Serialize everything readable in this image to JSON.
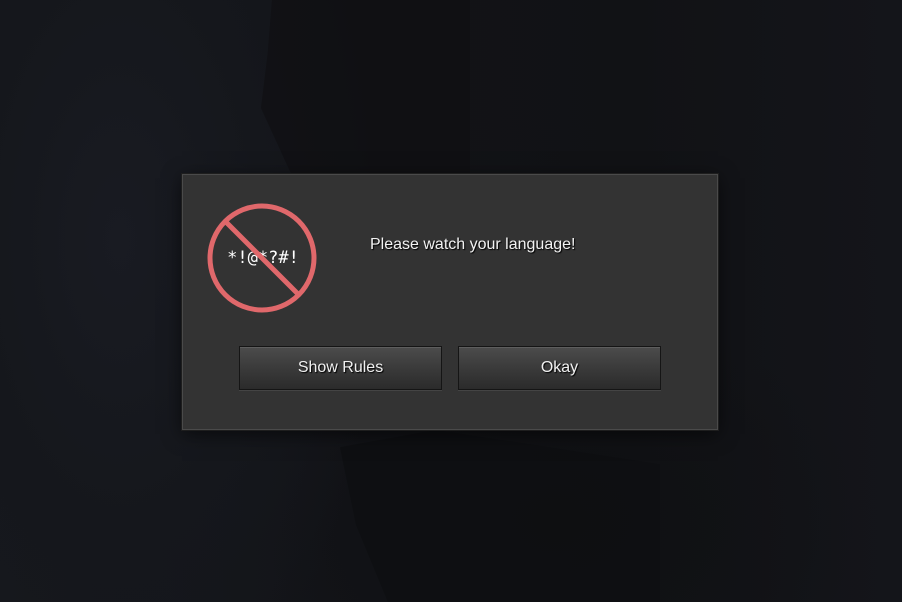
{
  "dialog": {
    "message": "Please watch your language!",
    "icon": {
      "name": "no-profanity-icon",
      "symbols": "*!@*?#!",
      "color": "#e0686b"
    },
    "buttons": {
      "show_rules_label": "Show Rules",
      "okay_label": "Okay"
    }
  },
  "colors": {
    "dialog_bg": "#333333",
    "button_text": "#f0f0f0",
    "background": "#131418"
  }
}
